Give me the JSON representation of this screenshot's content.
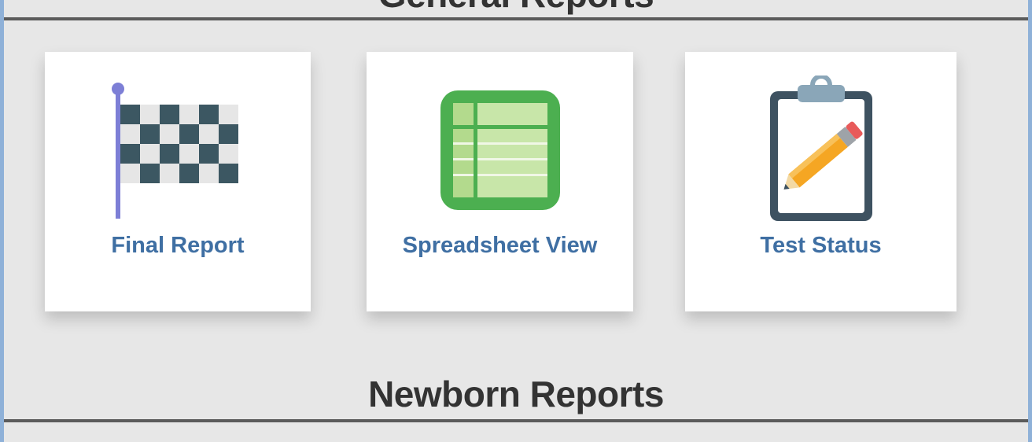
{
  "sections": {
    "top_title": "General Reports",
    "bottom_title": "Newborn Reports"
  },
  "tiles": [
    {
      "label": "Final Report",
      "icon": "checkered-flag-icon"
    },
    {
      "label": "Spreadsheet View",
      "icon": "spreadsheet-icon"
    },
    {
      "label": "Test Status",
      "icon": "clipboard-pencil-icon"
    }
  ],
  "colors": {
    "background": "#e7e7e7",
    "frame": "#8fb1d8",
    "label": "#3f6fa3",
    "divider": "#5b5b5b",
    "spreadsheet_green": "#4caf50",
    "clipboard_dark": "#3e5261",
    "pencil_orange": "#f5a623"
  }
}
